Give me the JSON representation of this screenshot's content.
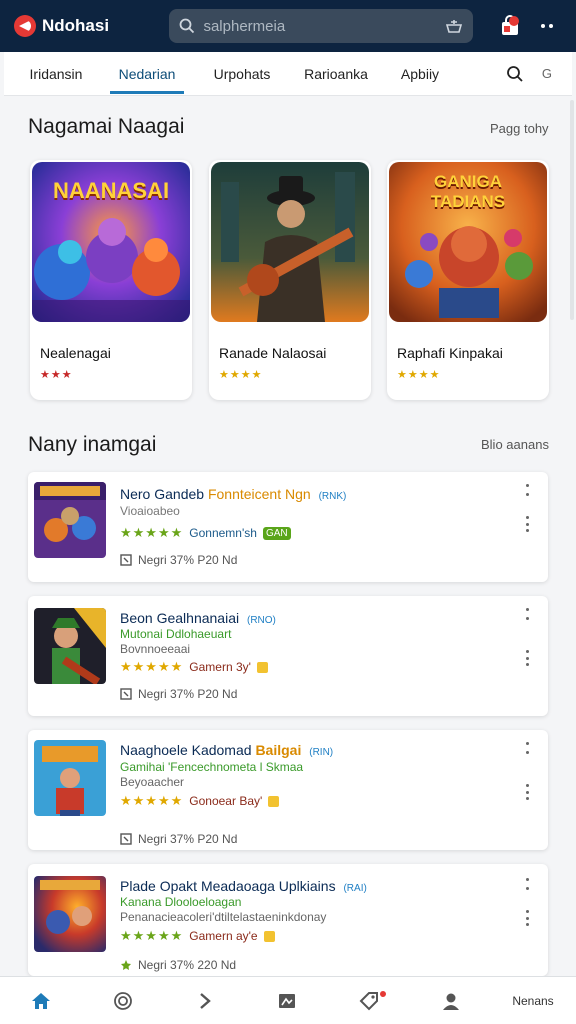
{
  "header": {
    "app_title": "Ndohasi",
    "search_placeholder": "salphermeia"
  },
  "tabs": [
    {
      "label": "Iridansin",
      "active": false
    },
    {
      "label": "Nedarian",
      "active": true
    },
    {
      "label": "Urpohats",
      "active": false
    },
    {
      "label": "Rarioanka",
      "active": false
    },
    {
      "label": "Apbiiy",
      "active": false
    }
  ],
  "tab_extra_label": "G",
  "featured": {
    "title": "Nagamai Naagai",
    "link": "Pagg tohy",
    "items": [
      {
        "art_text": "NAANASAI",
        "name": "Nealenagai",
        "stars": "★★★",
        "star_color": "#c62828"
      },
      {
        "art_text": "",
        "name": "Ranade Nalaosai",
        "stars": "★★★★",
        "star_color": "#e0a800"
      },
      {
        "art_text": "GANIGA TADIANS",
        "name": "Raphafi Kinpakai",
        "stars": "★★★★",
        "star_color": "#e0a800"
      }
    ]
  },
  "many": {
    "title": "Nany inamgai",
    "link": "Blio aanans",
    "items": [
      {
        "title": "Nero Gandeb",
        "title_hl": "Fonnteicent Ngn",
        "tag": "(RNK)",
        "sub1": "Vioaioabeo",
        "sub1_color": "#777",
        "sub2": "",
        "stars": "★★★★★",
        "rate_label": "Gonnemn'sh",
        "rate_badge": "GAN",
        "meta": "Negri 37%  P20 Nd"
      },
      {
        "title": "Beon Gealhnanaiai",
        "title_hl": "",
        "tag": "(RNO)",
        "sub1": "Mutonai Ddlohaeuart",
        "sub1_color": "#3a9a2a",
        "sub2": "Bovnnoeeaai",
        "stars": "★★★★★",
        "rate_label": "Gamern 3y'",
        "rate_badge": "",
        "meta": "Negri 37%  P20 Nd"
      },
      {
        "title": "Naaghoele Kadomad",
        "title_hl": "Bailgai",
        "tag": "(RIN)",
        "sub1": "Gamihai 'Fencechnometa l Skmaa",
        "sub1_color": "#3a9a2a",
        "sub2": "Beyoaacher",
        "stars": "★★★★★",
        "rate_label": "Gonoear Bay'",
        "rate_badge": "",
        "meta": "Negri 37%  P20 Nd"
      },
      {
        "title": "Plade Opakt Meadaoaga Uplkiains",
        "title_hl": "",
        "tag": "(RAI)",
        "sub1": "Kanana Dlooloeloagan",
        "sub1_color": "#3a9a2a",
        "sub2": "Penanacieacoleri'dtiltelastaeninkdonay",
        "stars": "★★★★★",
        "rate_label": "Gamern ay'e",
        "rate_badge": "",
        "meta": "Negri 37%  220 Nd"
      }
    ]
  },
  "bottom_nav": {
    "last_label": "Nenans"
  },
  "colors": {
    "topbar": "#0d2440",
    "accent": "#1e7bb8",
    "star_green": "#6aa519",
    "badge_red": "#e53935"
  }
}
